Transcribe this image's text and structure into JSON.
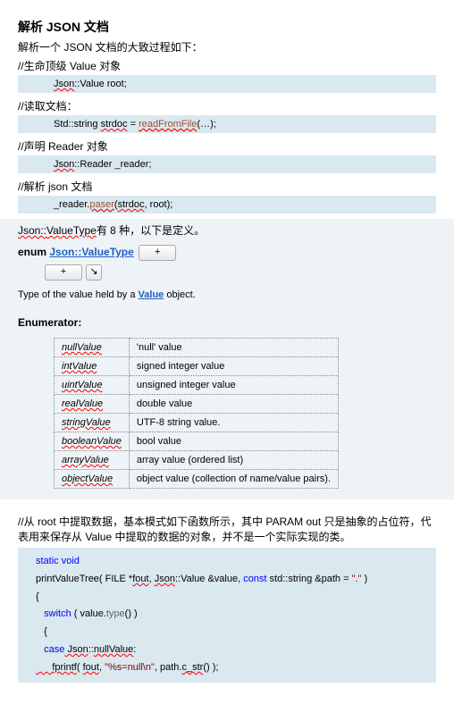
{
  "title": "解析 JSON 文档",
  "intro": "解析一个 JSON 文档的大致过程如下：",
  "sec1": {
    "comment": "//生命顶级 Value 对象",
    "ns": "Json",
    "sep": "::",
    "cls": "Value",
    "var": " root;"
  },
  "sec2": {
    "comment": "//读取文档：",
    "prefix": "Std::string ",
    "var": "strdoc",
    "eq": " = ",
    "fn": "readFromFile",
    "args": "(…);"
  },
  "sec3": {
    "comment": "//声明 Reader 对象",
    "ns": "Json",
    "sep": "::",
    "cls": "Reader",
    "var": " _reader;"
  },
  "sec4": {
    "comment": "//解析 json 文档",
    "obj": "_reader.",
    "fn": "paser",
    "args": "(",
    "a1": "strdoc",
    "c": ", root);"
  },
  "valuetype_line_a": "Json::",
  "valuetype_line_b": "ValueType",
  "valuetype_line_c": "有 8 种，以下是定义。",
  "enum_kw": "enum ",
  "enum_name": "Json::ValueType",
  "btn_plus": "+",
  "btn_arrow": "↘",
  "typeof_a": "Type of the value held by a ",
  "typeof_link": "Value",
  "typeof_b": " object.",
  "enum_hdr": "Enumerator:",
  "chart_data": {
    "type": "table",
    "rows": [
      {
        "name": "nullValue",
        "desc": "'null' value"
      },
      {
        "name": "intValue",
        "desc": "signed integer value"
      },
      {
        "name": "uintValue",
        "desc": "unsigned integer value"
      },
      {
        "name": "realValue",
        "desc": "double value"
      },
      {
        "name": "stringValue",
        "desc": "UTF-8 string value."
      },
      {
        "name": "booleanValue",
        "desc": "bool value"
      },
      {
        "name": "arrayValue",
        "desc": "array value (ordered list)"
      },
      {
        "name": "objectValue",
        "desc": "object value (collection of name/value pairs)."
      }
    ]
  },
  "extract_note": "//从 root 中提取数据，基本模式如下函数所示，其中 PARAM out 只是抽象的占位符，代表用来保存从 Value 中提取的数据的对象，并不是一个实际实现的类。",
  "code": {
    "l1a": "static",
    "l1b": " void",
    "l2a": "printValueTree( FILE *",
    "l2b": "fout",
    "l2c": ", ",
    "l2d": "Json",
    "l2e": "::Value &value, ",
    "l2f": "const",
    "l2g": " std::string &path = ",
    "l2h": "\".\"",
    "l2i": " )",
    "l3": "{",
    "l4a": "   switch",
    "l4b": " ( value.",
    "l4c": "type",
    "l4d": "() )",
    "l5": "   {",
    "l6a": "   case",
    "l6b": " Json",
    "l6c": "::",
    "l6d": "nullValue",
    "l6e": ":",
    "l7a": "      fprintf",
    "l7b": "( ",
    "l7c": "fout",
    "l7d": ", ",
    "l7e": "\"%s=null\\n\"",
    "l7f": ", path.",
    "l7g": "c_str",
    "l7h": "() );"
  }
}
